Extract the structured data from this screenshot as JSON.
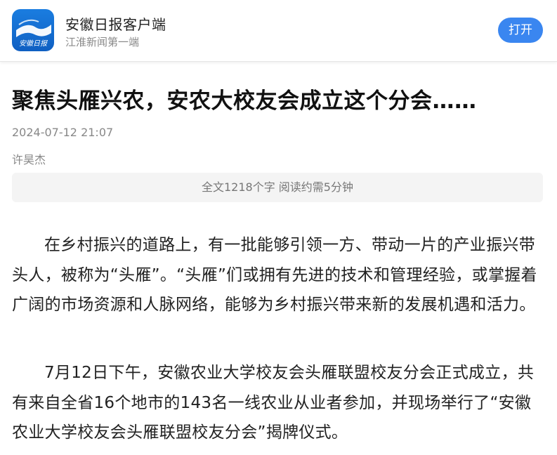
{
  "header": {
    "app_name": "安徽日报客户端",
    "slogan": "江淮新闻第一端",
    "logo_text": "安徽日报",
    "open_label": "打开",
    "brand_color": "#1a7de0",
    "button_color": "#3a86f0"
  },
  "article": {
    "title": "聚焦头雁兴农，安农大校友会成立这个分会……",
    "publish_time": "2024-07-12 21:07",
    "author": "许昊杰",
    "read_info": "全文1218个字 阅读约需5分钟",
    "paragraphs": [
      "在乡村振兴的道路上，有一批能够引领一方、带动一片的产业振兴带头人，被称为“头雁”。“头雁”们或拥有先进的技术和管理经验，或掌握着广阔的市场资源和人脉网络，能够为乡村振兴带来新的发展机遇和活力。",
      "7月12日下午，安徽农业大学校友会头雁联盟校友分会正式成立，共有来自全省16个地市的143名一线农业从业者参加，并现场举行了“安徽农业大学校友会头雁联盟校友分会”揭牌仪式。"
    ]
  }
}
